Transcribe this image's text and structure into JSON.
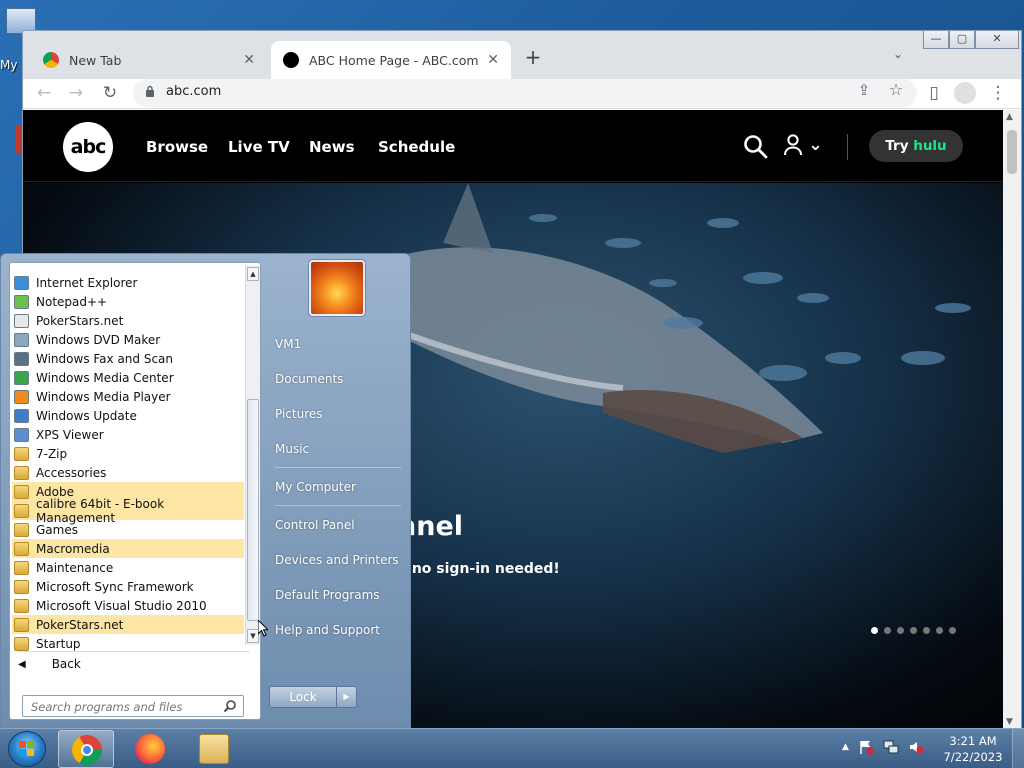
{
  "desktop": {
    "icon_label": "My"
  },
  "browser": {
    "window_controls": {
      "minimize": "—",
      "maximize": "▢",
      "close": "✕"
    },
    "tabs": [
      {
        "title": "New Tab",
        "close": "✕"
      },
      {
        "title": "ABC Home Page - ABC.com",
        "close": "✕"
      }
    ],
    "new_tab": "+",
    "tab_menu": "⌄",
    "nav": {
      "back": "←",
      "forward": "→",
      "reload": "↻"
    },
    "url": "abc.com",
    "toolbar_icons": {
      "share": "⇪",
      "bookmark": "☆",
      "sidepanel": "▯",
      "menu": "⋮"
    }
  },
  "site": {
    "logo": "abc",
    "nav": [
      "Browse",
      "Live TV",
      "News",
      "Schedule"
    ],
    "user_icon": "⌄",
    "try_prefix": "Try",
    "try_brand": "hulu",
    "hero": {
      "title": "nnel",
      "subtitle": "h no sign-in needed!"
    },
    "carousel": {
      "count": 7,
      "active": 0
    }
  },
  "start_menu": {
    "programs": [
      {
        "label": "Internet Explorer",
        "type": "app",
        "color": "#3b8fd9",
        "highlight": false
      },
      {
        "label": "Notepad++",
        "type": "app",
        "color": "#6bbf4e",
        "highlight": false
      },
      {
        "label": "PokerStars.net",
        "type": "app",
        "color": "#e8e8e8",
        "highlight": false
      },
      {
        "label": "Windows DVD Maker",
        "type": "app",
        "color": "#8fa6bf",
        "highlight": false
      },
      {
        "label": "Windows Fax and Scan",
        "type": "app",
        "color": "#5c6f85",
        "highlight": false
      },
      {
        "label": "Windows Media Center",
        "type": "app",
        "color": "#3aa44a",
        "highlight": false
      },
      {
        "label": "Windows Media Player",
        "type": "app",
        "color": "#f08a1c",
        "highlight": false
      },
      {
        "label": "Windows Update",
        "type": "app",
        "color": "#3b7fc9",
        "highlight": false
      },
      {
        "label": "XPS Viewer",
        "type": "app",
        "color": "#5d8fd0",
        "highlight": false
      },
      {
        "label": "7-Zip",
        "type": "folder",
        "highlight": false
      },
      {
        "label": "Accessories",
        "type": "folder",
        "highlight": false
      },
      {
        "label": "Adobe",
        "type": "folder",
        "highlight": true
      },
      {
        "label": "calibre 64bit - E-book Management",
        "type": "folder",
        "highlight": true
      },
      {
        "label": "Games",
        "type": "folder",
        "highlight": false
      },
      {
        "label": "Macromedia",
        "type": "folder",
        "highlight": true
      },
      {
        "label": "Maintenance",
        "type": "folder",
        "highlight": false
      },
      {
        "label": "Microsoft Sync Framework",
        "type": "folder",
        "highlight": false
      },
      {
        "label": "Microsoft Visual Studio 2010",
        "type": "folder",
        "highlight": false
      },
      {
        "label": "PokerStars.net",
        "type": "folder",
        "highlight": true
      },
      {
        "label": "Startup",
        "type": "folder",
        "highlight": false
      }
    ],
    "back_label": "Back",
    "back_arrow": "◀",
    "search_placeholder": "Search programs and files",
    "right_items": [
      {
        "label": "VM1"
      },
      {
        "label": "Documents"
      },
      {
        "label": "Pictures"
      },
      {
        "label": "Music"
      },
      {
        "label": "My Computer"
      },
      {
        "label": "Control Panel"
      },
      {
        "label": "Devices and Printers"
      },
      {
        "label": "Default Programs"
      },
      {
        "label": "Help and Support"
      }
    ],
    "lock_label": "Lock",
    "lock_arrow": "▶"
  },
  "taskbar": {
    "apps": [
      {
        "name": "chrome",
        "active": true
      },
      {
        "name": "firefox",
        "active": false
      },
      {
        "name": "explorer",
        "active": false
      }
    ],
    "tray_arrow": "▲",
    "time": "3:21 AM",
    "date": "7/22/2023"
  }
}
